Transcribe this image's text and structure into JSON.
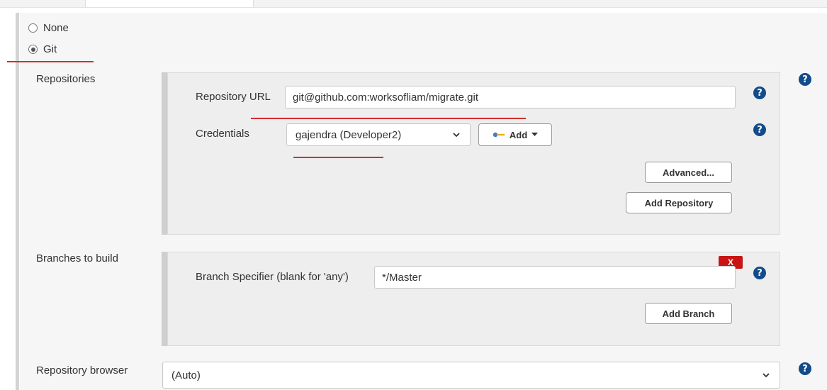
{
  "scm": {
    "options": [
      {
        "label": "None",
        "selected": false
      },
      {
        "label": "Git",
        "selected": true
      }
    ]
  },
  "repositories": {
    "section_label": "Repositories",
    "url_label": "Repository URL",
    "url_value": "git@github.com:worksofliam/migrate.git",
    "credentials_label": "Credentials",
    "credentials_value": "gajendra (Developer2)",
    "add_label": "Add",
    "advanced_label": "Advanced...",
    "add_repository_label": "Add Repository"
  },
  "branches": {
    "section_label": "Branches to build",
    "delete_label": "X",
    "specifier_label": "Branch Specifier (blank for 'any')",
    "specifier_value": "*/Master",
    "add_branch_label": "Add Branch"
  },
  "browser": {
    "label": "Repository browser",
    "value": "(Auto)"
  },
  "help_glyph": "?",
  "colors": {
    "help": "#114b8a",
    "annotation": "#d32f2f",
    "delete_badge": "#c81414"
  }
}
